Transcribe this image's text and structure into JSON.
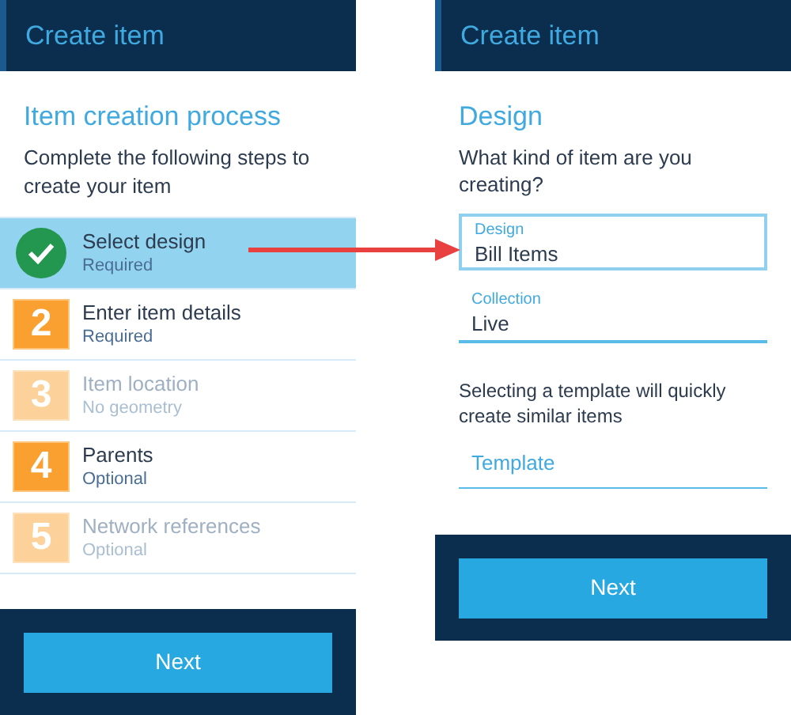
{
  "left_panel": {
    "title": "Create item",
    "heading": "Item creation process",
    "intro": "Complete the following steps to create your item",
    "steps": [
      {
        "kind": "complete",
        "label": "Select design",
        "note": "Required",
        "selected": true
      },
      {
        "kind": "available",
        "number": "2",
        "label": "Enter item details",
        "note": "Required",
        "selected": false
      },
      {
        "kind": "disabled",
        "number": "3",
        "label": "Item location",
        "note": "No geometry",
        "selected": false
      },
      {
        "kind": "available",
        "number": "4",
        "label": "Parents",
        "note": "Optional",
        "selected": false
      },
      {
        "kind": "disabled",
        "number": "5",
        "label": "Network references",
        "note": "Optional",
        "selected": false
      }
    ],
    "button": "Next"
  },
  "right_panel": {
    "title": "Create item",
    "heading": "Design",
    "question": "What kind of item are you creating?",
    "fields": [
      {
        "label": "Design",
        "value": "Bill Items",
        "focused": true
      },
      {
        "label": "Collection",
        "value": "Live",
        "focused": false
      }
    ],
    "template_hint": "Selecting a template will quickly create similar items",
    "template": {
      "placeholder": "Template"
    },
    "button": "Next"
  }
}
